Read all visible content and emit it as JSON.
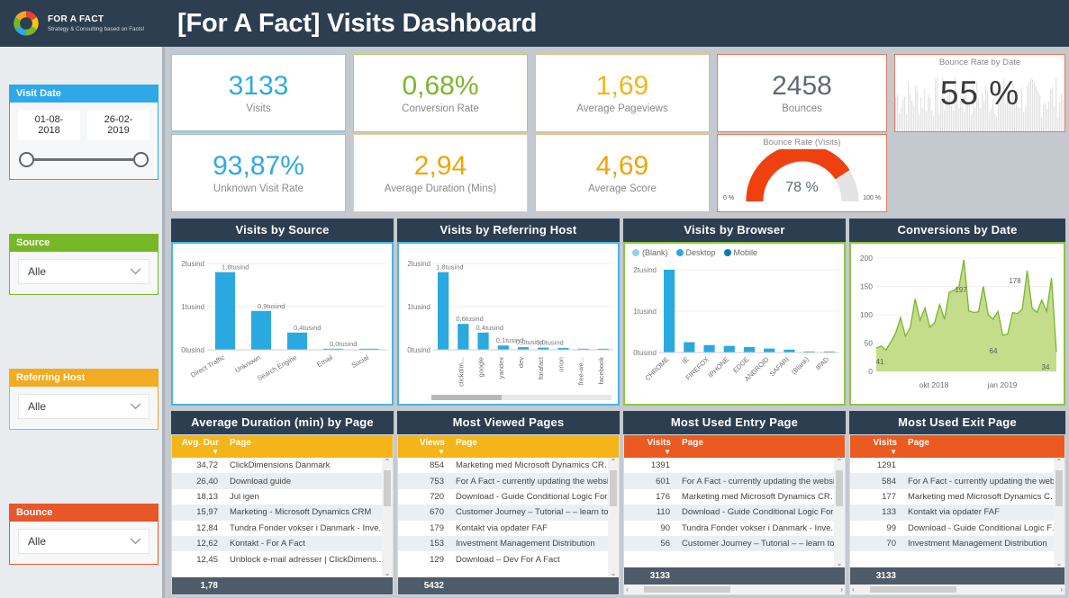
{
  "header": {
    "logo_title": "FOR A FACT",
    "logo_sub": "Strategy & Consulting based on Facts!",
    "title": "[For A Fact] Visits Dashboard"
  },
  "sidebar": {
    "visit_date": {
      "label": "Visit Date",
      "from": "01-08-2018",
      "to": "26-02-2019",
      "color": "#2fa8e8"
    },
    "source": {
      "label": "Source",
      "value": "Alle",
      "color": "#76b828"
    },
    "referring_host": {
      "label": "Referring Host",
      "value": "Alle",
      "color": "#f2ab23"
    },
    "bounce": {
      "label": "Bounce",
      "value": "Alle",
      "color": "#e8562a"
    }
  },
  "kpis": [
    {
      "value": "3133",
      "label": "Visits",
      "color": "#2fa8e8"
    },
    {
      "value": "0,68%",
      "label": "Conversion Rate",
      "color": "#7db52b"
    },
    {
      "value": "1,69",
      "label": "Average Pageviews",
      "color": "#f5b518"
    },
    {
      "value": "2458",
      "label": "Bounces",
      "color": "#5f6a72"
    },
    {
      "value": "93,87%",
      "label": "Unknown Visit Rate",
      "color": "#2fa8e8"
    },
    {
      "value": "2,94",
      "label": "Average Duration (Mins)",
      "color": "#f0a500"
    },
    {
      "value": "4,69",
      "label": "Average Score",
      "color": "#f0a500"
    }
  ],
  "gauge": {
    "title": "Bounce Rate (Visits)",
    "value": "78 %",
    "min_label": "0 %",
    "max_label": "100 %",
    "percent": 78,
    "color": "#ef4010"
  },
  "bounce_rate_by_date": {
    "title": "Bounce Rate by Date",
    "value": "55 %"
  },
  "panels": {
    "visits_by_source": "Visits by Source",
    "visits_by_referring_host": "Visits by Referring Host",
    "visits_by_browser": "Visits by Browser",
    "conversions_by_date": "Conversions by Date",
    "avg_duration_by_page": "Average Duration (min) by Page",
    "most_viewed_pages": "Most Viewed Pages",
    "most_used_entry_page": "Most Used Entry Page",
    "most_used_exit_page": "Most Used Exit Page"
  },
  "chart_data": [
    {
      "type": "bar",
      "title": "Visits by Source",
      "categories": [
        "Direct Traffic",
        "Unknown",
        "Search Engine",
        "Email",
        "Social"
      ],
      "values": [
        1800,
        900,
        400,
        20,
        10
      ],
      "data_labels": [
        "1,8tusind",
        "0,9tusind",
        "0,4tusind",
        "0,0tusind",
        ""
      ],
      "ytick_labels": [
        "0tusind",
        "1tusind",
        "2tusind"
      ],
      "ylim": [
        0,
        2000
      ],
      "color": "#2aa9e0",
      "xlabel": "",
      "ylabel": ""
    },
    {
      "type": "bar",
      "title": "Visits by Referring Host",
      "categories": [
        "",
        "clickdim...",
        "google",
        "yandex",
        "dev",
        "forafact",
        "orion",
        "free-we...",
        "facebook"
      ],
      "values": [
        1800,
        600,
        400,
        100,
        60,
        50,
        45,
        25,
        15
      ],
      "data_labels": [
        "1,8tusind",
        "0,6tusind",
        "0,4tusind",
        "0,1tusind",
        "0,0tusind",
        "0,0tusind",
        "",
        "",
        ""
      ],
      "ytick_labels": [
        "0tusind",
        "1tusind",
        "2tusind"
      ],
      "ylim": [
        0,
        2000
      ],
      "color": "#2aa9e0",
      "xlabel": "",
      "ylabel": ""
    },
    {
      "type": "bar",
      "title": "Visits by Browser",
      "categories": [
        "CHROME",
        "IE",
        "FIREFOX",
        "IPHONE",
        "EDGE",
        "ANDROID",
        "SAFARI",
        "(Blank)",
        "IPAD"
      ],
      "values": [
        2000,
        250,
        180,
        160,
        130,
        95,
        70,
        20,
        12
      ],
      "ytick_labels": [
        "0tusind",
        "1tusind",
        "2tusind"
      ],
      "ylim": [
        0,
        2000
      ],
      "legend": [
        "(Blank)",
        "Desktop",
        "Mobile"
      ],
      "legend_colors": [
        "#8ed2f0",
        "#2aa9e0",
        "#0c7ab5"
      ],
      "color": "#2aa9e0",
      "xlabel": "",
      "ylabel": ""
    },
    {
      "type": "area",
      "title": "Conversions by Date",
      "xlabel": "",
      "ylabel": "",
      "xtick_labels": [
        "okt 2018",
        "jan 2019"
      ],
      "ytick_labels": [
        "0",
        "50",
        "100",
        "150",
        "200"
      ],
      "ylim": [
        0,
        200
      ],
      "annotations": [
        {
          "text": "41",
          "value": 41
        },
        {
          "text": "197",
          "value": 197
        },
        {
          "text": "178",
          "value": 178
        },
        {
          "text": "64",
          "value": 64
        },
        {
          "text": "34",
          "value": 34
        }
      ],
      "values": [
        41,
        45,
        38,
        52,
        68,
        95,
        62,
        78,
        128,
        90,
        112,
        78,
        86,
        118,
        92,
        140,
        143,
        150,
        197,
        107,
        104,
        105,
        150,
        100,
        92,
        106,
        64,
        66,
        104,
        102,
        110,
        178,
        112,
        104,
        126,
        106,
        165,
        34
      ],
      "color": "#b5d66c",
      "line_color": "#6aa62e"
    }
  ],
  "tables": {
    "avg_duration": {
      "headers": {
        "num": "Avg. Dur",
        "page": "Page"
      },
      "header_color": "#f5b518",
      "rows": [
        {
          "num": "34,72",
          "page": "ClickDimensions Danmark"
        },
        {
          "num": "26,40",
          "page": "Download guide"
        },
        {
          "num": "18,13",
          "page": "Jul igen"
        },
        {
          "num": "15,97",
          "page": "Marketing - Microsoft Dynamics CRM"
        },
        {
          "num": "12,84",
          "page": "Tundra Fonder vokser i Danmark - Inve..."
        },
        {
          "num": "12,62",
          "page": "Kontakt - For A Fact"
        },
        {
          "num": "12,45",
          "page": "Unblock e-mail adresser | ClickDimens..."
        }
      ],
      "total": "1,78"
    },
    "most_viewed": {
      "headers": {
        "num": "Views",
        "page": "Page"
      },
      "header_color": "#f5b518",
      "rows": [
        {
          "num": "854",
          "page": "Marketing med Microsoft Dynamics CRM ..."
        },
        {
          "num": "753",
          "page": "For A Fact - currently updating the websit..."
        },
        {
          "num": "720",
          "page": "Download - Guide Conditional Logic Form"
        },
        {
          "num": "670",
          "page": "Customer Journey – Tutorial – – learn to in..."
        },
        {
          "num": "179",
          "page": "Kontakt via opdater FAF"
        },
        {
          "num": "153",
          "page": "Investment Management Distribution"
        },
        {
          "num": "129",
          "page": "Download – Dev For A Fact"
        }
      ],
      "total": "5432"
    },
    "entry_page": {
      "headers": {
        "num": "Visits",
        "page": "Page"
      },
      "header_color": "#eb5a20",
      "rows": [
        {
          "num": "1391",
          "page": ""
        },
        {
          "num": "601",
          "page": "For A Fact - currently updating the website - F"
        },
        {
          "num": "176",
          "page": "Marketing med Microsoft Dynamics CRM | Cl"
        },
        {
          "num": "110",
          "page": "Download - Guide Conditional Logic Form"
        },
        {
          "num": "90",
          "page": "Tundra Fonder vokser i Danmark - Inve..."
        },
        {
          "num": "56",
          "page": "Customer Journey – Tutorial – – learn to in bu"
        }
      ],
      "total": "3133"
    },
    "exit_page": {
      "headers": {
        "num": "Visits",
        "page": "Page"
      },
      "header_color": "#eb5a20",
      "rows": [
        {
          "num": "1291",
          "page": ""
        },
        {
          "num": "584",
          "page": "For A Fact - currently updating the website - F"
        },
        {
          "num": "177",
          "page": "Marketing med Microsoft Dynamics CRM | Cli"
        },
        {
          "num": "133",
          "page": "Kontakt via opdater FAF"
        },
        {
          "num": "99",
          "page": "Download - Guide Conditional Logic Form"
        },
        {
          "num": "70",
          "page": "Investment Management Distribution"
        }
      ],
      "total": "3133"
    }
  },
  "icons": {
    "chevron_down": "chevron-down-icon",
    "sort_desc": "▼",
    "scroll_up": "⌃",
    "scroll_down": "⌄",
    "scroll_left": "‹",
    "scroll_right": "›"
  }
}
